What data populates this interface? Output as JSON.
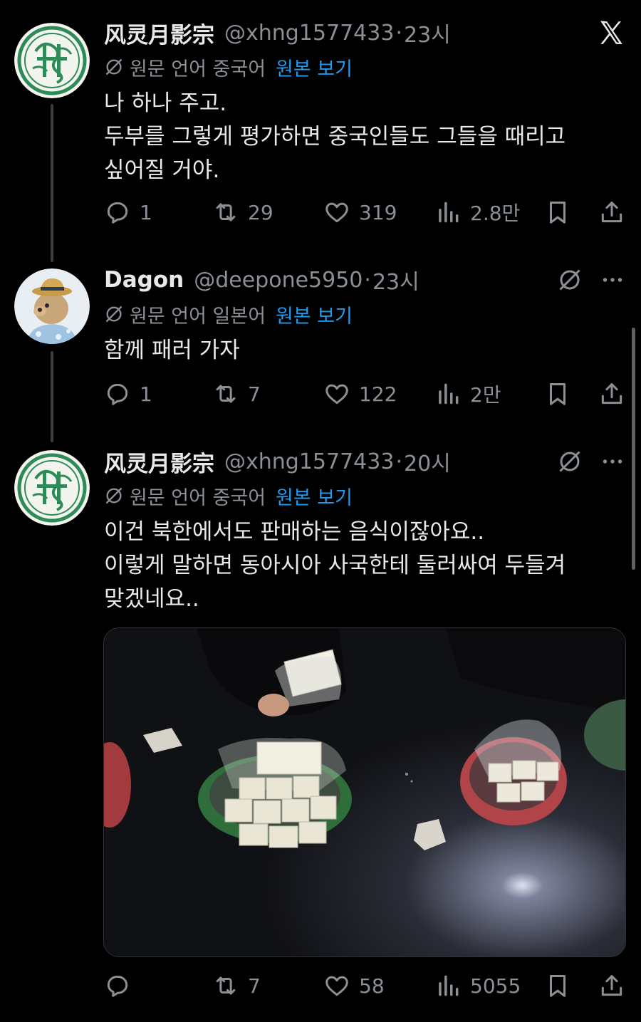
{
  "tweets": [
    {
      "name": "风灵月影宗",
      "handle": "@xhng1577433",
      "dot": "·",
      "time": "23시",
      "translation": {
        "label": "원문 언어 중국어",
        "show_original": "원본 보기"
      },
      "body": "나 하나 주고.\n두부를 그렇게 평가하면 중국인들도 그들을 때리고\n싶어질 거야.",
      "replies": "1",
      "reposts": "29",
      "likes": "319",
      "views": "2.8만"
    },
    {
      "name": "Dagon",
      "handle": "@deepone5950",
      "dot": "·",
      "time": "23시",
      "translation": {
        "label": "원문 언어 일본어",
        "show_original": "원본 보기"
      },
      "body": "함께 패러 가자",
      "replies": "1",
      "reposts": "7",
      "likes": "122",
      "views": "2만"
    },
    {
      "name": "风灵月影宗",
      "handle": "@xhng1577433",
      "dot": "·",
      "time": "20시",
      "translation": {
        "label": "원문 언어 중국어",
        "show_original": "원본 보기"
      },
      "body": "이건 북한에서도 판매하는 음식이잖아요..\n이렇게 말하면 동아시아 사국한테 둘러싸여 두들겨\n맞겠네요..",
      "replies": "",
      "reposts": "7",
      "likes": "58",
      "views": "5055"
    }
  ],
  "icons": {
    "close": "x-close-icon",
    "translate": "translate-off-icon",
    "more": "more-dots-icon",
    "reply": "reply-icon",
    "repost": "repost-icon",
    "like": "heart-icon",
    "views": "views-icon",
    "bookmark": "bookmark-icon",
    "share": "share-icon"
  },
  "colors": {
    "background": "#000000",
    "text": "#e7e9ea",
    "muted": "#8b9096",
    "link": "#1d9bf0"
  }
}
